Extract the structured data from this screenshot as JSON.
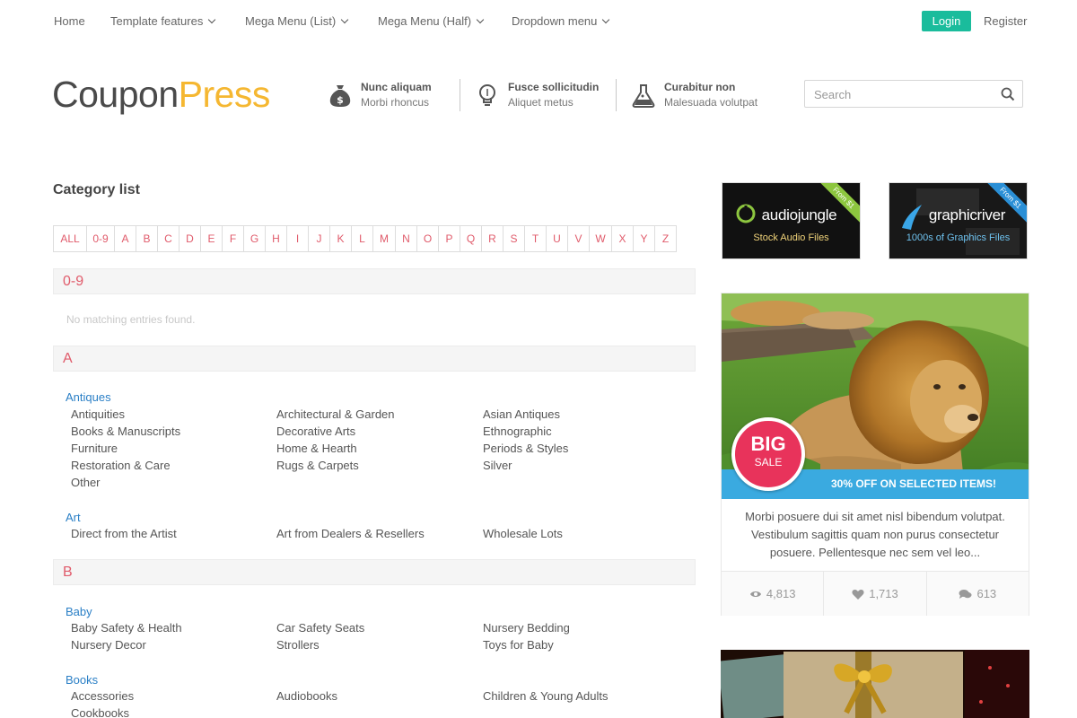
{
  "nav": {
    "home": "Home",
    "template_features": "Template features",
    "mega_list": "Mega Menu (List)",
    "mega_half": "Mega Menu (Half)",
    "dropdown": "Dropdown menu",
    "login": "Login",
    "register": "Register"
  },
  "logo": {
    "part1": "Coupon",
    "part2": "Press"
  },
  "features": [
    {
      "title": "Nunc aliquam",
      "subtitle": "Morbi rhoncus",
      "icon": "money-bag-icon"
    },
    {
      "title": "Fusce sollicitudin",
      "subtitle": "Aliquet metus",
      "icon": "lightbulb-icon"
    },
    {
      "title": "Curabitur non",
      "subtitle": "Malesuada volutpat",
      "icon": "flask-icon"
    }
  ],
  "search": {
    "placeholder": "Search"
  },
  "main": {
    "title": "Category list",
    "alphabet": [
      "ALL",
      "0-9",
      "A",
      "B",
      "C",
      "D",
      "E",
      "F",
      "G",
      "H",
      "I",
      "J",
      "K",
      "L",
      "M",
      "N",
      "O",
      "P",
      "Q",
      "R",
      "S",
      "T",
      "U",
      "V",
      "W",
      "X",
      "Y",
      "Z"
    ],
    "groups": {
      "g09": {
        "label": "0-9",
        "empty": "No matching entries found."
      },
      "gA": {
        "label": "A",
        "antiques": {
          "title": "Antiques",
          "items": [
            "Antiquities",
            "Architectural & Garden",
            "Asian Antiques",
            "Books & Manuscripts",
            "Decorative Arts",
            "Ethnographic",
            "Furniture",
            "Home & Hearth",
            "Periods & Styles",
            "Restoration & Care",
            "Rugs & Carpets",
            "Silver",
            "Other"
          ]
        },
        "art": {
          "title": "Art",
          "items": [
            "Direct from the Artist",
            "Art from Dealers & Resellers",
            "Wholesale Lots"
          ]
        }
      },
      "gB": {
        "label": "B",
        "baby": {
          "title": "Baby",
          "items": [
            "Baby Safety & Health",
            "Car Safety Seats",
            "Nursery Bedding",
            "Nursery Decor",
            "Strollers",
            "Toys for Baby"
          ]
        },
        "books": {
          "title": "Books",
          "items": [
            "Accessories",
            "Audiobooks",
            "Children & Young Adults",
            "Cookbooks"
          ]
        }
      }
    }
  },
  "sidebar": {
    "ad1": {
      "brand": "audiojungle",
      "tagline": "Stock Audio Files",
      "ribbon": "From $1",
      "accent": "#8dc63f"
    },
    "ad2": {
      "brand": "graphicriver",
      "tagline": "1000s of Graphics Files",
      "ribbon": "From $1",
      "accent": "#2a8fd6"
    },
    "card": {
      "badge_big": "BIG",
      "badge_sale": "SALE",
      "promo": "30% OFF ON SELECTED ITEMS!",
      "description": "Morbi posuere dui sit amet nisl bibendum volutpat. Vestibulum sagittis quam non purus consectetur posuere. Pellentesque nec sem vel leo...",
      "views": "4,813",
      "likes": "1,713",
      "comments": "613"
    }
  },
  "colors": {
    "accent_teal": "#1abc9c",
    "letter_red": "#e05b6b",
    "link_blue": "#2a7fc6",
    "logo_yellow": "#f5b731",
    "promo_blue": "#3aaae0",
    "sale_red": "#e8335b"
  }
}
